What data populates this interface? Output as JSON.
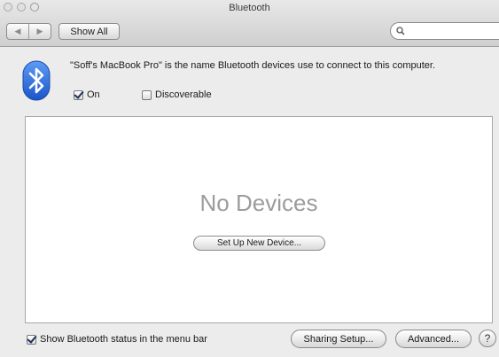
{
  "window": {
    "title": "Bluetooth"
  },
  "toolbar": {
    "back_icon": "back-arrow-icon",
    "forward_icon": "forward-arrow-icon",
    "show_all_label": "Show All",
    "search_value": "",
    "search_placeholder": ""
  },
  "info": {
    "text": "\"Soff's MacBook Pro\" is the name Bluetooth devices use to connect to this computer.",
    "on_label": "On",
    "on_checked": true,
    "discoverable_label": "Discoverable",
    "discoverable_checked": false
  },
  "devices": {
    "empty_text": "No Devices",
    "setup_button_label": "Set Up New Device..."
  },
  "footer": {
    "show_status_label": "Show Bluetooth status in the menu bar",
    "show_status_checked": true,
    "sharing_label": "Sharing Setup...",
    "advanced_label": "Advanced...",
    "help_label": "?"
  },
  "colors": {
    "bluetooth_logo": "#2b6fe0",
    "window_background": "#ececec"
  }
}
